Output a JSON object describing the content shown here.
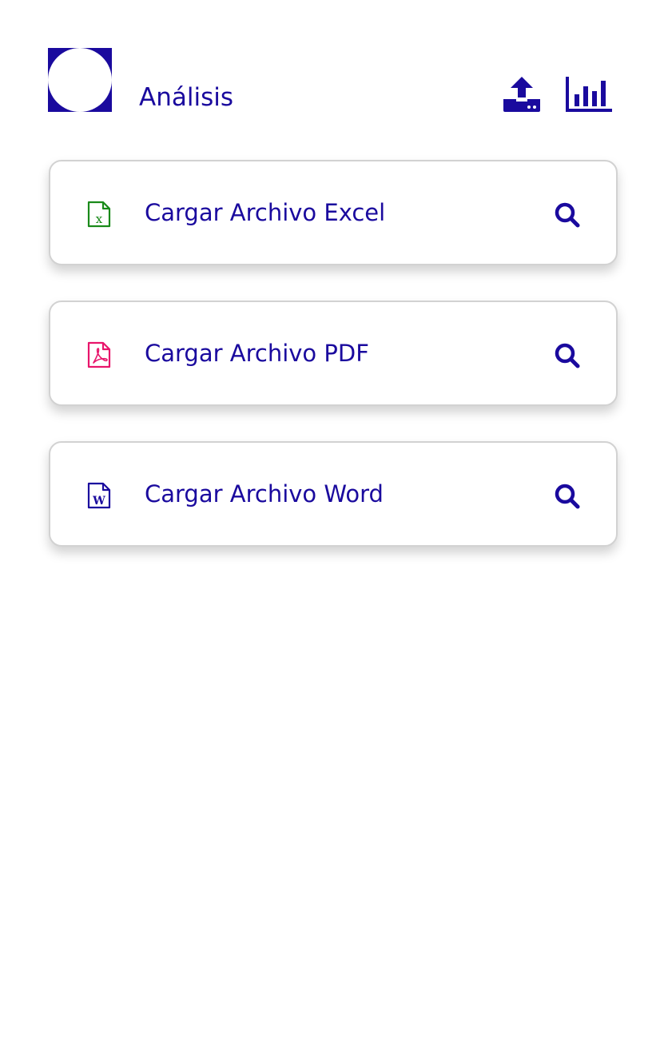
{
  "header": {
    "title": "Análisis",
    "icons": {
      "logo": "logo-mark",
      "upload": "upload-icon",
      "chart": "bar-chart-icon"
    }
  },
  "cards": [
    {
      "label": "Cargar Archivo Excel",
      "icon": "excel-file-icon",
      "icon_color": "#1a8a1a"
    },
    {
      "label": "Cargar Archivo PDF",
      "icon": "pdf-file-icon",
      "icon_color": "#e8156b"
    },
    {
      "label": "Cargar Archivo Word",
      "icon": "word-file-icon",
      "icon_color": "#1a0a9e"
    }
  ],
  "colors": {
    "primary": "#1a0a9e",
    "card_border": "#d2d2d2",
    "background": "#ffffff"
  }
}
